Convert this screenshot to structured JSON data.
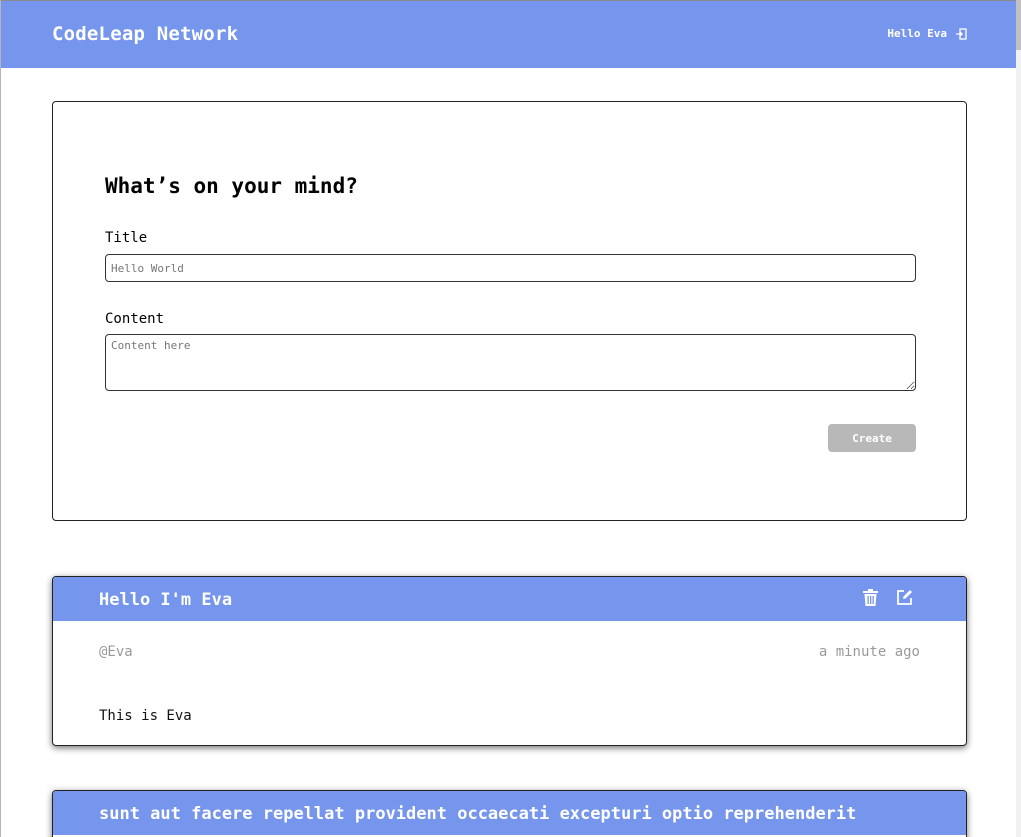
{
  "header": {
    "brand": "CodeLeap Network",
    "greeting": "Hello Eva",
    "logout_icon": "logout-icon"
  },
  "create_form": {
    "heading": "What’s on your mind?",
    "title_label": "Title",
    "title_placeholder": "Hello World",
    "title_value": "",
    "content_label": "Content",
    "content_placeholder": "Content here",
    "content_value": "",
    "submit_label": "Create",
    "submit_state": "disabled"
  },
  "posts": [
    {
      "title": "Hello I'm Eva",
      "username": "@Eva",
      "time": "a minute ago",
      "content": "This is Eva",
      "icons": [
        "trash-icon",
        "edit-icon"
      ]
    },
    {
      "title": "sunt aut facere repellat provident occaecati excepturi optio reprehenderit"
    }
  ],
  "colors": {
    "accent": "#7695ec",
    "muted_text": "#9a9a9a",
    "disabled_button": "#b8b8b8"
  }
}
